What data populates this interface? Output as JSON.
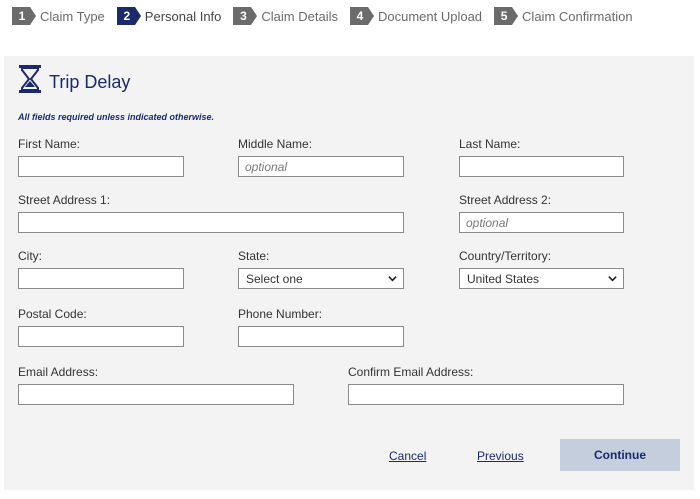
{
  "steps": [
    {
      "number": "1",
      "label": "Claim Type"
    },
    {
      "number": "2",
      "label": "Personal Info"
    },
    {
      "number": "3",
      "label": "Claim Details"
    },
    {
      "number": "4",
      "label": "Document Upload"
    },
    {
      "number": "5",
      "label": "Claim Confirmation"
    }
  ],
  "active_step": "2",
  "colors": {
    "brand": "#1b2a6b",
    "inactive_step": "#6b6b6b",
    "panel_bg": "#f3f3f3",
    "continue_bg": "#c5cedd"
  },
  "form": {
    "title": "Trip Delay",
    "title_icon": "hourglass-icon",
    "required_note": "All fields required unless indicated otherwise.",
    "first_name": {
      "label": "First Name:",
      "value": "",
      "placeholder": ""
    },
    "middle_name": {
      "label": "Middle Name:",
      "value": "",
      "placeholder": "optional"
    },
    "last_name": {
      "label": "Last Name:",
      "value": "",
      "placeholder": ""
    },
    "street1": {
      "label": "Street Address 1:",
      "value": "",
      "placeholder": ""
    },
    "street2": {
      "label": "Street Address 2:",
      "value": "",
      "placeholder": "optional"
    },
    "city": {
      "label": "City:",
      "value": "",
      "placeholder": ""
    },
    "state": {
      "label": "State:",
      "selected": "Select one"
    },
    "country": {
      "label": "Country/Territory:",
      "selected": "United States"
    },
    "postal_code": {
      "label": "Postal Code:",
      "value": "",
      "placeholder": ""
    },
    "phone": {
      "label": "Phone Number:",
      "value": "",
      "placeholder": ""
    },
    "email": {
      "label": "Email Address:",
      "value": "",
      "placeholder": ""
    },
    "confirm_email": {
      "label": "Confirm Email Address:",
      "value": "",
      "placeholder": ""
    }
  },
  "actions": {
    "cancel": "Cancel",
    "previous": "Previous",
    "continue": "Continue"
  }
}
